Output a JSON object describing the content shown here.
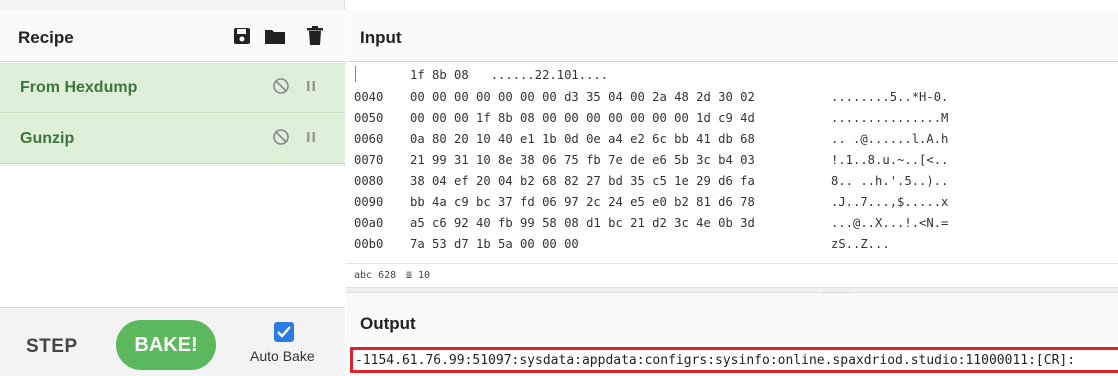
{
  "recipe": {
    "title": "Recipe",
    "header_icons": [
      "save-icon",
      "folder-icon",
      "trash-icon"
    ],
    "operations": [
      {
        "label": "From Hexdump",
        "icons": [
          "disable-icon",
          "pause-icon"
        ]
      },
      {
        "label": "Gunzip",
        "icons": [
          "disable-icon",
          "pause-icon"
        ]
      }
    ]
  },
  "controls": {
    "step_label": "STEP",
    "bake_label": "BAKE!",
    "auto_bake_label": "Auto Bake",
    "auto_bake_checked": true
  },
  "input": {
    "title": "Input",
    "first_line": "1f 8b 08   ......22.101....",
    "rows": [
      {
        "offset": "0040",
        "hex": "00 00 00 00 00 00 00 d3 35 04 00 2a 48 2d 30 02",
        "ascii": "........5..*H-0."
      },
      {
        "offset": "0050",
        "hex": "00 00 00 1f 8b 08 00 00 00 00 00 00 00 1d c9 4d",
        "ascii": "...............M"
      },
      {
        "offset": "0060",
        "hex": "0a 80 20 10 40 e1 1b 0d 0e a4 e2 6c bb 41 db 68",
        "ascii": ".. .@......l.A.h"
      },
      {
        "offset": "0070",
        "hex": "21 99 31 10 8e 38 06 75 fb 7e de e6 5b 3c b4 03",
        "ascii": "!.1..8.u.~..[<.."
      },
      {
        "offset": "0080",
        "hex": "38 04 ef 20 04 b2 68 82 27 bd 35 c5 1e 29 d6 fa",
        "ascii": "8.. ..h.'.5..).."
      },
      {
        "offset": "0090",
        "hex": "bb 4a c9 bc 37 fd 06 97 2c 24 e5 e0 b2 81 d6 78",
        "ascii": ".J..7...,$.....x"
      },
      {
        "offset": "00a0",
        "hex": "a5 c6 92 40 fb 99 58 08 d1 bc 21 d2 3c 4e 0b 3d",
        "ascii": "...@..X...!.<N.="
      },
      {
        "offset": "00b0",
        "hex": "7a 53 d7 1b 5a 00 00 00",
        "ascii": "zS..Z..."
      }
    ],
    "status": {
      "length_label": "abc 628",
      "lines_label": "≣ 10"
    }
  },
  "output": {
    "title": "Output",
    "text": "-1154.61.76.99:51097:sysdata:appdata:configrs:sysinfo:online.spaxdriod.studio:11000011:[CR]:"
  },
  "colors": {
    "op_background": "#dff0d8",
    "op_text": "#3c763d",
    "bake_button": "#5cb85c",
    "checkbox": "#2c7be5",
    "output_highlight": "#e0202a"
  }
}
